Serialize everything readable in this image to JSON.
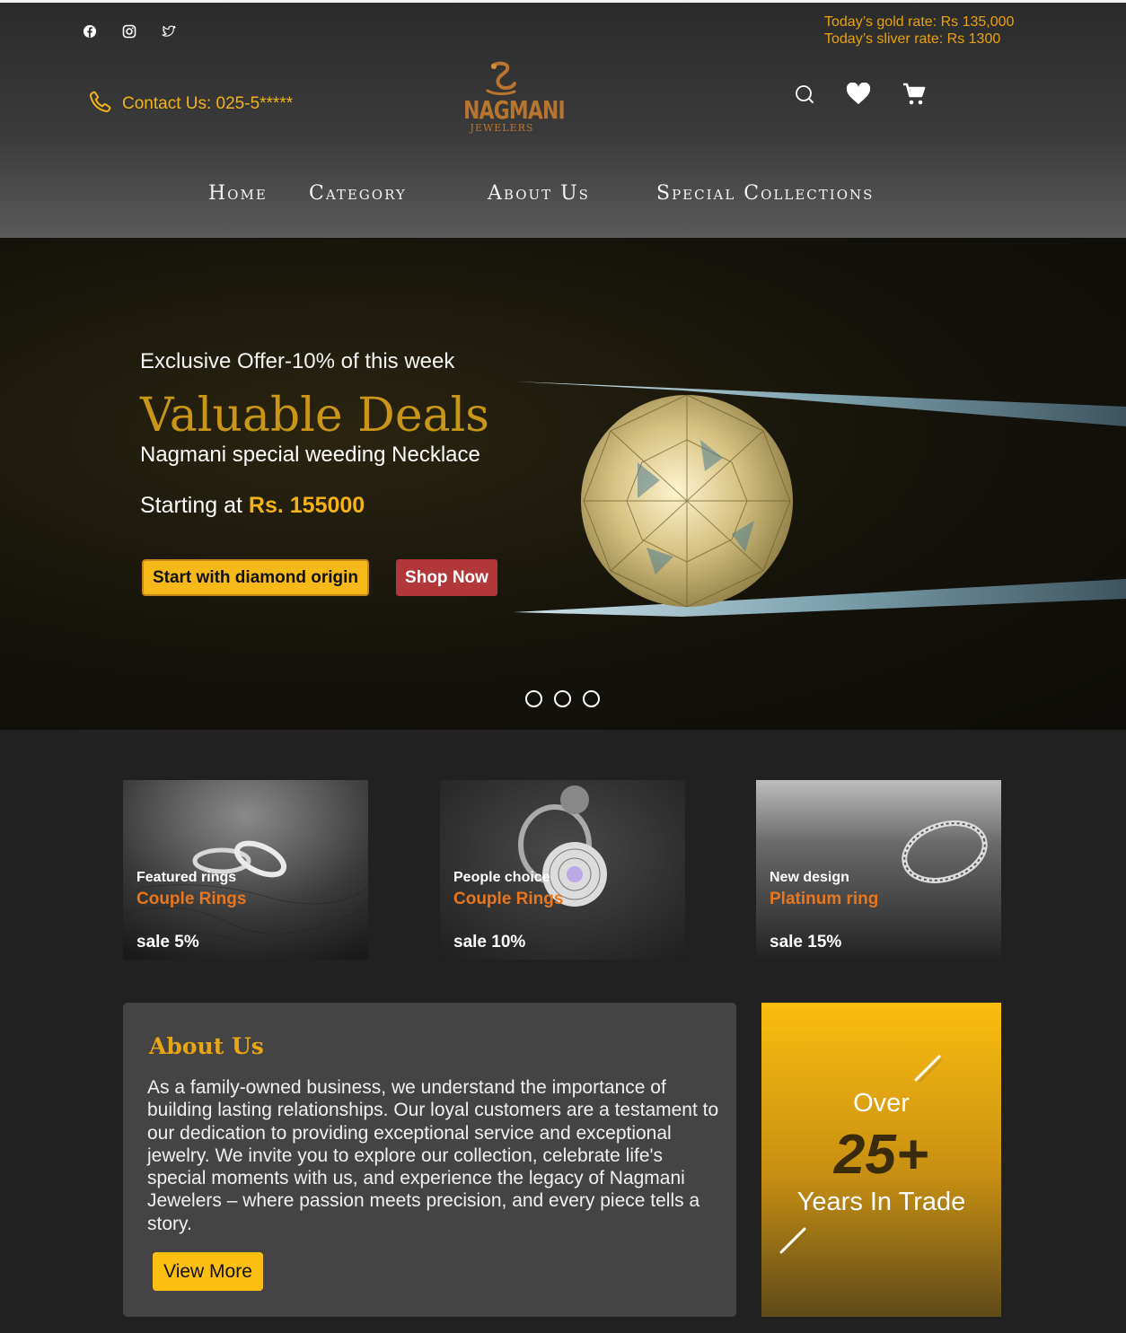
{
  "social": {
    "facebook": "facebook-icon",
    "instagram": "instagram-icon",
    "twitter": "twitter-icon"
  },
  "rates": {
    "gold": "Today’s gold rate: Rs 135,000",
    "silver": "Today’s sliver rate: Rs 1300"
  },
  "contact": {
    "label": "Contact Us: 025-5*****",
    "icon": "phone-icon"
  },
  "logo": {
    "brand": "NAGMANI",
    "sub": "JEWELERS"
  },
  "actions": {
    "search": "search-icon",
    "wishlist": "heart-icon",
    "cart": "cart-icon"
  },
  "nav": {
    "home": "Home",
    "category": "Category",
    "about": "About Us",
    "special": "Special Collections"
  },
  "hero": {
    "offer": "Exclusive Offer-10% of this week",
    "title": "Valuable Deals",
    "subtitle": "Nagmani special weeding Necklace",
    "price_prefix": "Starting at",
    "price_value": "Rs. 155000",
    "btn_diamond": "Start with diamond origin",
    "btn_shop": "Shop Now",
    "slides": 3
  },
  "cards": [
    {
      "kicker": "Featured rings",
      "name": "Couple Rings",
      "sale": "sale 5%"
    },
    {
      "kicker": "People choice",
      "name": "Couple Rings",
      "sale": "sale 10%"
    },
    {
      "kicker": "New design",
      "name": "Platinum ring",
      "sale": "sale 15%"
    }
  ],
  "about": {
    "heading": "About Us",
    "body": "As a family-owned business, we understand the importance of building lasting relationships. Our loyal customers are a testament to our dedication to providing exceptional service and exceptional jewelry. We invite you to explore our collection, celebrate life's special moments with us, and experience the legacy of Nagmani Jewelers – where passion meets precision, and every piece tells a story.",
    "button": "View More"
  },
  "trade": {
    "over": "Over",
    "number": "25+",
    "label": "Years In Trade"
  },
  "colors": {
    "accent": "#fcbd10",
    "brand": "#b8752e",
    "shop": "#b2373a",
    "sale": "#e8761e"
  }
}
